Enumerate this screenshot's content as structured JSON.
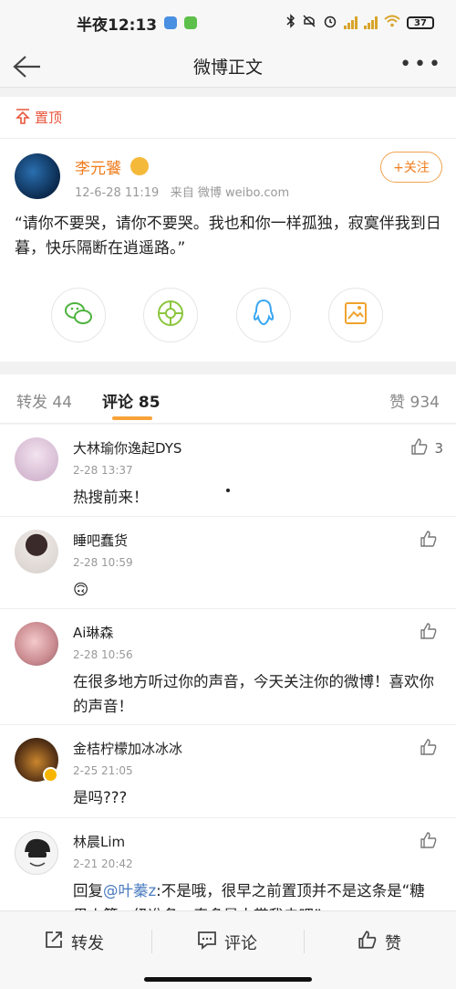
{
  "status_bar": {
    "time": "半夜12:13",
    "battery": "37"
  },
  "nav": {
    "title": "微博正文"
  },
  "pin": {
    "label": "置顶"
  },
  "post": {
    "author": "李元饕",
    "timestamp": "12-6-28 11:19",
    "source": "来自 微博 weibo.com",
    "follow_label": "+关注",
    "content": "“请你不要哭，请你不要哭。我也和你一样孤独，寂寞伴我到日暮，快乐隔断在逍遥路。”",
    "share_icons": [
      "wechat-icon",
      "moments-icon",
      "qq-icon",
      "save-image-icon"
    ]
  },
  "tabs": {
    "repost": "转发 44",
    "comments": "评论 85",
    "likes": "赞 934"
  },
  "comments": [
    {
      "name": "大林瑜你逸起DYS",
      "time": "2-28 13:37",
      "text": "热搜前来！",
      "likes": "3"
    },
    {
      "name": "睡吧蠢货",
      "time": "2-28 10:59",
      "text": "🙃",
      "likes": ""
    },
    {
      "name": "Ai琳森",
      "time": "2-28 10:56",
      "text": "在很多地方听过你的声音，今天关注你的微博！喜欢你的声音！",
      "likes": ""
    },
    {
      "name": "金桔柠檬加冰冰冰",
      "time": "2-25 21:05",
      "text": "是吗???",
      "likes": ""
    },
    {
      "name": "林晨Lim",
      "time": "2-21 20:42",
      "text_prefix": "回复",
      "mention": "@叶蓁z",
      "text_suffix": ":不是哦，很早之前置顶并不是这条是“糖果火箭一级准备，奇多是人带我去吧”",
      "likes": ""
    }
  ],
  "bottom_bar": {
    "repost": "转发",
    "comment": "评论",
    "like": "赞"
  },
  "colors": {
    "accent": "#f07c1c",
    "mention": "#4a7bbf",
    "pin": "#e8553b"
  }
}
